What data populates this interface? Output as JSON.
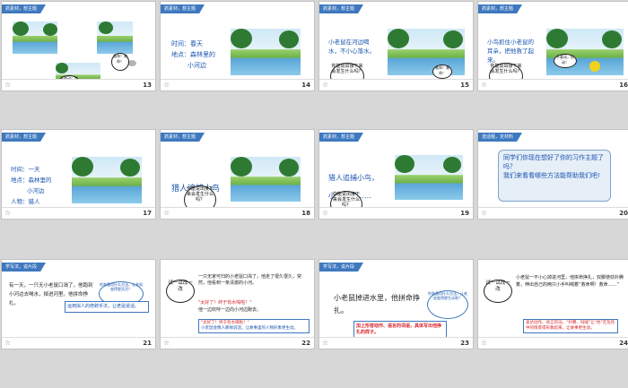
{
  "slides": [
    {
      "tag": "抓素材，想主题",
      "num": "13",
      "bubble_big": "救命！救命！",
      "bubble_small": "不要动！别动！"
    },
    {
      "tag": "抓素材，想主题",
      "num": "14",
      "line1": "时间：春天",
      "line2": "地点：森林里的",
      "line3": "小河边"
    },
    {
      "tag": "抓素材，想主题",
      "num": "15",
      "text": "小老鼠在河边喝水，不小心落水。",
      "bubble_top": "救命！救命！",
      "bubble_q": "你能说出接下来会发生什么吗？"
    },
    {
      "tag": "抓素材，想主题",
      "num": "16",
      "text": "小鸟抓住小老鼠的耳朵，把他救了起来。",
      "bubble_top": "不要动，别动！",
      "bubble_q": "你能说出接下来会发生什么吗？"
    },
    {
      "tag": "抓素材，想主题",
      "num": "17",
      "line1": "时间：一天",
      "line2": "地点：森林里的",
      "line3": "小河边",
      "line4": "人物：猎人"
    },
    {
      "tag": "抓素材，想主题",
      "num": "18",
      "text": "猎人追捕小鸟",
      "bubble_q": "你能说出接下来会发生什么吗？"
    },
    {
      "tag": "抓素材，想主题",
      "num": "19",
      "line1": "猎人追捕小鸟，",
      "line2": "小鸟逃跑……",
      "bubble_q": "你能说出接下来会发生什么吗？"
    },
    {
      "tag": "选话题，定材料",
      "num": "20",
      "line1": "同学们你现在想好了你的习作主题了吗？",
      "line2": "我们来看看哪些方法能帮助我们吧!"
    },
    {
      "tag": "学写法，说片段",
      "num": "21",
      "text": "有一天，一只无小老鼠口渴了，他跑到小河边去喝水，掉进河里。他拼命挣扎。",
      "bubble": "你准备用什么方法，让老鼠变得更灵活？",
      "note": "运用拟人的修辞手法，让老鼠说话。"
    },
    {
      "tag": "学写法，说片段",
      "num": "22",
      "bubble": "试一试改一改",
      "para1": "一只无家可归的小老鼠口渴了，他走了很久很久，突然，他看到一条清澈的小河。",
      "quote": "\"太好了！终于有水喝啦！\"",
      "para2": "他一边欢呼一边向小河边跑去。",
      "note1": "\"太好了！终于有水喝啦！\"",
      "note2": "小老鼠会像人那样说话，让故事里的人物形象更生动。"
    },
    {
      "tag": "学写法，说片段",
      "num": "23",
      "text": "小老鼠掉进水里，他拼命挣扎。",
      "bubble": "你准备用什么方法，让老鼠变得更生动呢？",
      "note": "加上形容动作、语言的词语，具体写出他挣扎的样子。"
    },
    {
      "tag": "学写法，说片段",
      "num": "24",
      "bubble": "试一试改一改",
      "para": "小老鼠一不小心掉进河里，他拼命挣扎，双脚使劲扑腾着，伸出自己的两只小手叫喊着“救命啊！救命……”",
      "note": "表达动作、语言的词，“扑腾、叫喊”让“他”在危险中的情景得形象起来，让故事更生动。"
    }
  ]
}
